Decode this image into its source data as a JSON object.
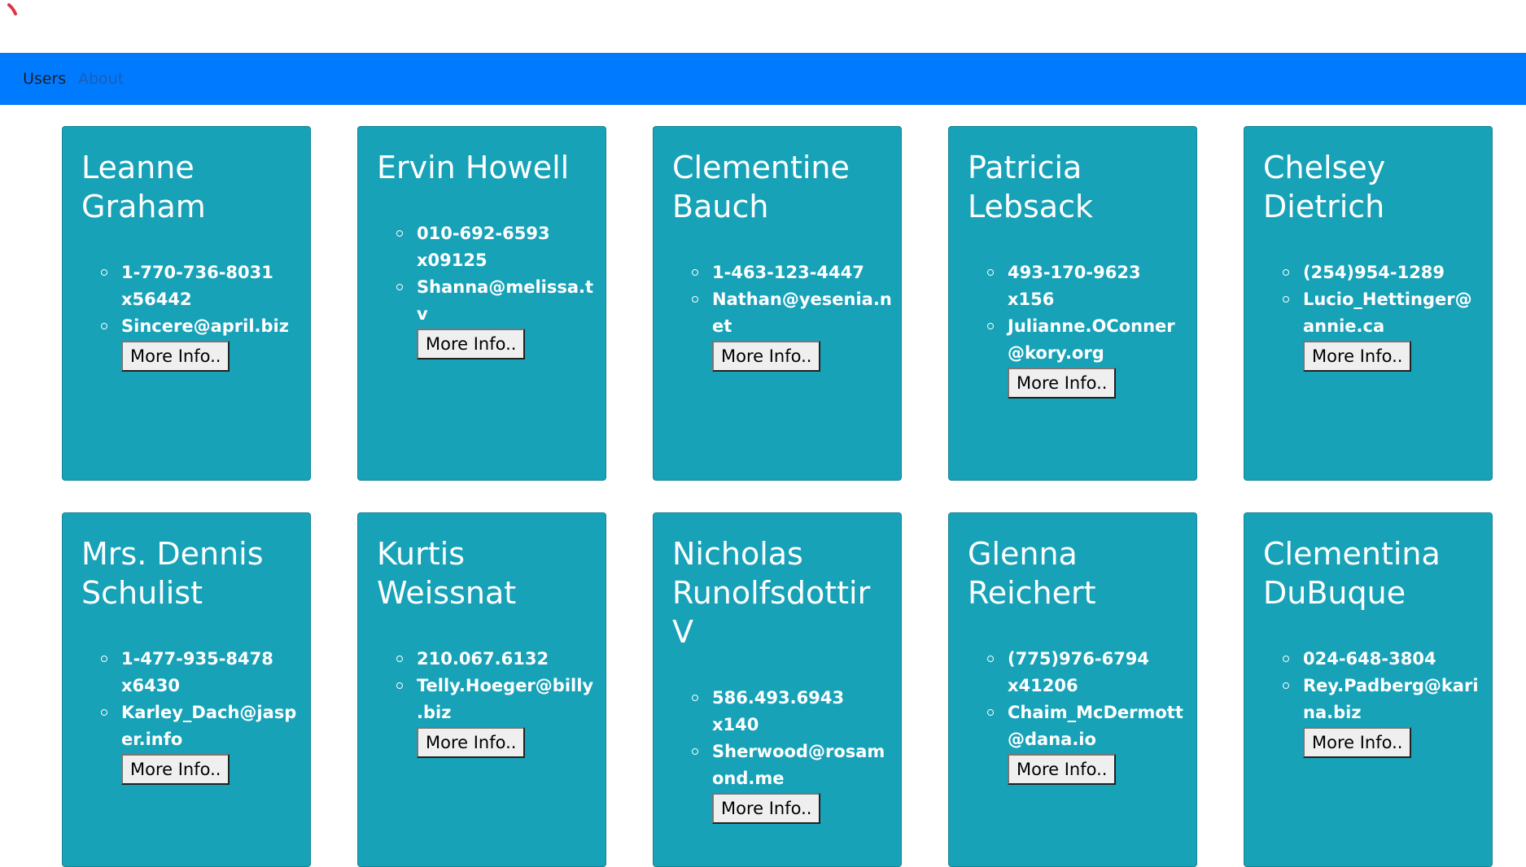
{
  "nav": {
    "users_label": "Users",
    "about_label": "About"
  },
  "colors": {
    "navbar": "#007bff",
    "card": "#17a2b8",
    "spinner": "#dc3545"
  },
  "users": [
    {
      "name": "Leanne Graham",
      "phone": "1-770-736-8031 x56442",
      "email": "Sincere@april.biz",
      "button": "More Info.."
    },
    {
      "name": "Ervin Howell",
      "phone": "010-692-6593 x09125",
      "email": "Shanna@melissa.tv",
      "button": "More Info.."
    },
    {
      "name": "Clementine Bauch",
      "phone": "1-463-123-4447",
      "email": "Nathan@yesenia.net",
      "button": "More Info.."
    },
    {
      "name": "Patricia Lebsack",
      "phone": "493-170-9623 x156",
      "email": "Julianne.OConner@kory.org",
      "button": "More Info.."
    },
    {
      "name": "Chelsey Dietrich",
      "phone": "(254)954-1289",
      "email": "Lucio_Hettinger@annie.ca",
      "button": "More Info.."
    },
    {
      "name": "Mrs. Dennis Schulist",
      "phone": "1-477-935-8478 x6430",
      "email": "Karley_Dach@jasper.info",
      "button": "More Info.."
    },
    {
      "name": "Kurtis Weissnat",
      "phone": "210.067.6132",
      "email": "Telly.Hoeger@billy.biz",
      "button": "More Info.."
    },
    {
      "name": "Nicholas Runolfsdottir V",
      "phone": "586.493.6943 x140",
      "email": "Sherwood@rosamond.me",
      "button": "More Info.."
    },
    {
      "name": "Glenna Reichert",
      "phone": "(775)976-6794 x41206",
      "email": "Chaim_McDermott@dana.io",
      "button": "More Info.."
    },
    {
      "name": "Clementina DuBuque",
      "phone": "024-648-3804",
      "email": "Rey.Padberg@karina.biz",
      "button": "More Info.."
    }
  ]
}
